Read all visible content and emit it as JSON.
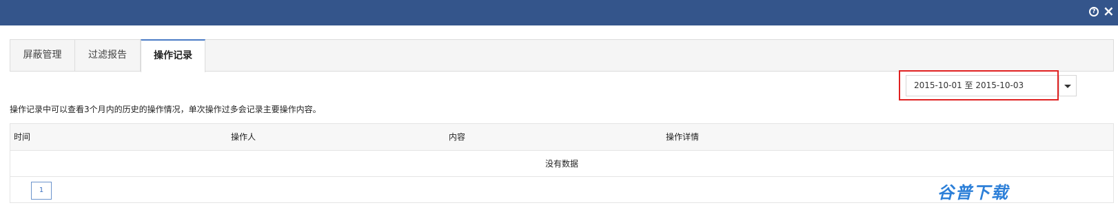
{
  "header": {
    "help_icon": "?",
    "close_icon": "×"
  },
  "tabs": [
    {
      "label": "屏蔽管理"
    },
    {
      "label": "过滤报告"
    },
    {
      "label": "操作记录"
    }
  ],
  "filter": {
    "date_range": "2015-10-01 至 2015-10-03"
  },
  "description": "操作记录中可以查看3个月内的历史的操作情况，单次操作过多会记录主要操作内容。",
  "table": {
    "columns": [
      "时间",
      "操作人",
      "内容",
      "操作详情"
    ],
    "empty_text": "没有数据"
  },
  "pagination": {
    "current_page": "1"
  },
  "watermark": "谷普下载",
  "colors": {
    "header_bg": "#34558b",
    "highlight_border": "#e02020",
    "active_tab_accent": "#4a7bc6"
  }
}
